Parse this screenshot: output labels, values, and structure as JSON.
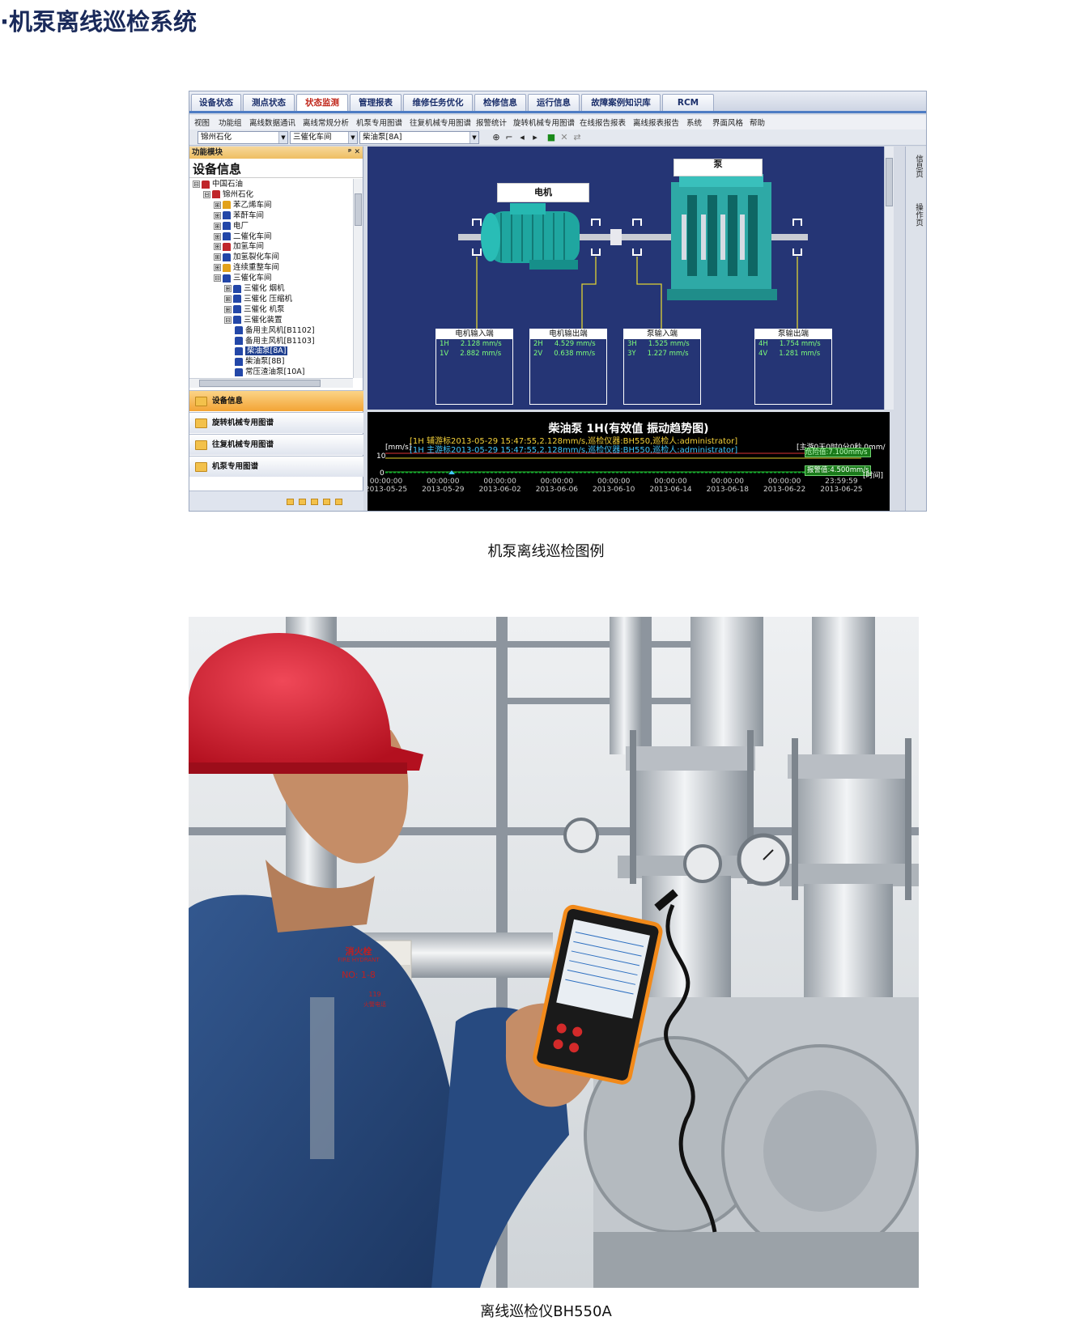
{
  "page_title": "·机泵离线巡检系统",
  "tabs": [
    "设备状态",
    "测点状态",
    "状态监测",
    "管理报表",
    "维修任务优化",
    "检修信息",
    "运行信息",
    "故障案例知识库",
    "RCM"
  ],
  "active_tab": "状态监测",
  "menu": [
    "视图",
    "功能组",
    "离线数据通讯",
    "离线常规分析",
    "机泵专用图谱",
    "往复机械专用图谱",
    "报警统计",
    "旋转机械专用图谱",
    "在线报告报表",
    "离线报表报告",
    "系统",
    "界面风格",
    "帮助"
  ],
  "toolbar": {
    "combo1": "锦州石化",
    "combo2": "三催化车间",
    "combo3": "柴油泵[8A]"
  },
  "left_panel": {
    "header": "功能模块",
    "header_controls": "ᵖ ✕",
    "title": "设备信息",
    "tree": [
      {
        "label": "中国石油",
        "level": 0,
        "exp": "⊟",
        "color": "#c0262a"
      },
      {
        "label": "锦州石化",
        "level": 1,
        "exp": "⊟",
        "color": "#c0262a"
      },
      {
        "label": "苯乙烯车间",
        "level": 2,
        "exp": "⊞",
        "color": "#e3a21a"
      },
      {
        "label": "苯酐车间",
        "level": 2,
        "exp": "⊞",
        "color": "#2347a8"
      },
      {
        "label": "电厂",
        "level": 2,
        "exp": "⊞",
        "color": "#2347a8"
      },
      {
        "label": "二催化车间",
        "level": 2,
        "exp": "⊞",
        "color": "#2347a8"
      },
      {
        "label": "加氢车间",
        "level": 2,
        "exp": "⊞",
        "color": "#c0262a"
      },
      {
        "label": "加氢裂化车间",
        "level": 2,
        "exp": "⊞",
        "color": "#2347a8"
      },
      {
        "label": "连续重整车间",
        "level": 2,
        "exp": "⊞",
        "color": "#e3a21a"
      },
      {
        "label": "三催化车间",
        "level": 2,
        "exp": "⊟",
        "color": "#2347a8"
      },
      {
        "label": "三催化 烟机",
        "level": 3,
        "exp": "⊞",
        "color": "#2347a8"
      },
      {
        "label": "三催化 压缩机",
        "level": 3,
        "exp": "⊞",
        "color": "#2347a8"
      },
      {
        "label": "三催化 机泵",
        "level": 3,
        "exp": "⊞",
        "color": "#2347a8"
      },
      {
        "label": "三催化装置",
        "level": 3,
        "exp": "⊟",
        "color": "#2347a8"
      },
      {
        "label": "备用主风机[B1102]",
        "level": 4,
        "exp": "",
        "color": "#2347a8"
      },
      {
        "label": "备用主风机[B1103]",
        "level": 4,
        "exp": "",
        "color": "#2347a8"
      },
      {
        "label": "柴油泵[8A]",
        "level": 4,
        "exp": "",
        "color": "#2347a8",
        "selected": true
      },
      {
        "label": "柴油泵[8B]",
        "level": 4,
        "exp": "",
        "color": "#2347a8"
      },
      {
        "label": "常压渣油泵[10A]",
        "level": 4,
        "exp": "",
        "color": "#2347a8"
      }
    ],
    "nav": [
      "设备信息",
      "旋转机械专用图谱",
      "往复机械专用图谱",
      "机泵专用图谱"
    ],
    "nav_active": "设备信息"
  },
  "side_tabs": [
    "信息页",
    "操作页"
  ],
  "diagram": {
    "motor_label": "电机",
    "pump_label": "泵",
    "boxes": [
      {
        "title": "电机输入端",
        "rows": [
          [
            "1H",
            "2.128 mm/s"
          ],
          [
            "1V",
            "2.882 mm/s"
          ]
        ]
      },
      {
        "title": "电机输出端",
        "rows": [
          [
            "2H",
            "4.529 mm/s"
          ],
          [
            "2V",
            "0.638 mm/s"
          ]
        ]
      },
      {
        "title": "泵输入端",
        "rows": [
          [
            "3H",
            "1.525 mm/s"
          ],
          [
            "3Y",
            "1.227 mm/s"
          ]
        ]
      },
      {
        "title": "泵输出端",
        "rows": [
          [
            "4H",
            "1.754 mm/s"
          ],
          [
            "4V",
            "1.281 mm/s"
          ]
        ]
      }
    ]
  },
  "trend": {
    "title": "柴油泵 1H(有效值 振动趋势图)",
    "cursor1": "[1H 辅游标2013-05-29 15:47:55,2.128mm/s,巡检仪器:BH550,巡检人:administrator]",
    "cursor2": "[1H 主游标2013-05-29 15:47:55,2.128mm/s,巡检仪器:BH550,巡检人:administrator]",
    "unit": "[mm/s]",
    "y_top": "10",
    "y_bottom": "0",
    "time_label": "[时间]",
    "overlap_text": "[主游0天0时0分0秒,0mm/",
    "alarm_upper": "危险值:7.100mm/s",
    "alarm_lower": "报警值:4.500mm/s",
    "x_ticks": [
      [
        "00:00:00",
        "2013-05-25"
      ],
      [
        "00:00:00",
        "2013-05-29"
      ],
      [
        "00:00:00",
        "2013-06-02"
      ],
      [
        "00:00:00",
        "2013-06-06"
      ],
      [
        "00:00:00",
        "2013-06-10"
      ],
      [
        "00:00:00",
        "2013-06-14"
      ],
      [
        "00:00:00",
        "2013-06-18"
      ],
      [
        "00:00:00",
        "2013-06-22"
      ],
      [
        "23:59:59",
        "2013-06-25"
      ]
    ]
  },
  "caption1": "机泵离线巡检图例",
  "photo": {
    "sign_line1": "消火栓",
    "sign_line2": "FIRE HYDRANT",
    "sign_line3": "NO: 1-8",
    "sign_line4": "119",
    "sign_line5": "火警电话"
  },
  "caption2": "离线巡检仪BH550A",
  "colors": {
    "title": "#1a2a5a",
    "diagram_bg": "#253575",
    "active_tab": "#c0261a",
    "value_green": "#7dff7a"
  }
}
